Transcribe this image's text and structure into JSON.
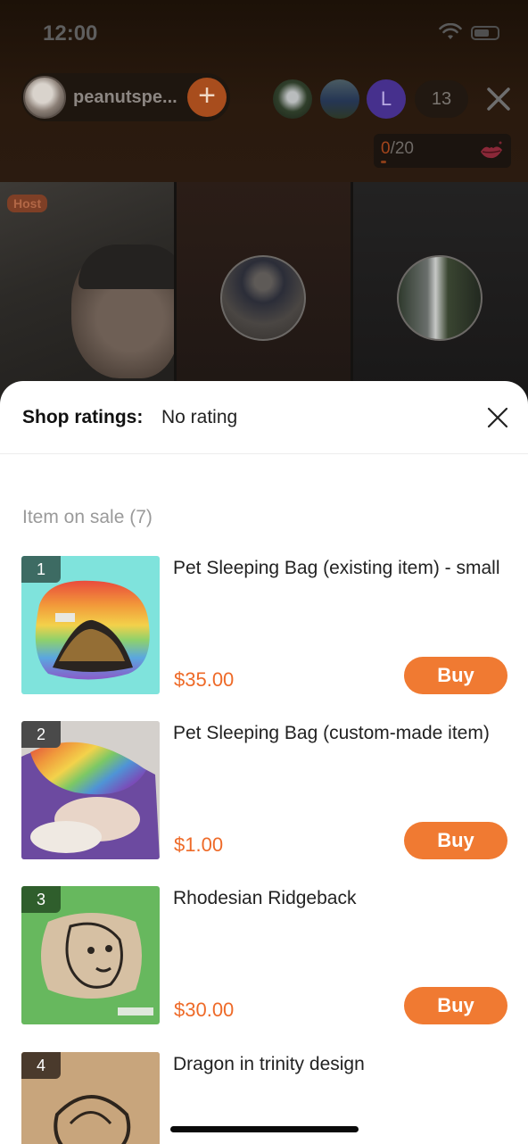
{
  "status_bar": {
    "time": "12:00"
  },
  "live": {
    "host_name": "peanutspe...",
    "follow_symbol": "+",
    "viewers": [
      {
        "kind": "photo",
        "initial": ""
      },
      {
        "kind": "photo",
        "initial": ""
      },
      {
        "kind": "letter",
        "initial": "L"
      }
    ],
    "viewer_count": "13",
    "gift_current": "0",
    "gift_total": "/20",
    "host_tag": "Host"
  },
  "sheet": {
    "ratings_label": "Shop ratings:",
    "ratings_value": "No rating",
    "section_title": "Item on sale (7)",
    "buy_label": "Buy",
    "items": [
      {
        "index": "1",
        "title": "Pet Sleeping Bag (existing item) - small",
        "price": "$35.00",
        "index_color": "#3d6b63",
        "bg": "#7fe3dc"
      },
      {
        "index": "2",
        "title": "Pet Sleeping Bag (custom-made item)",
        "price": "$1.00",
        "index_color": "#4a4a4a",
        "bg": "#cfcbc6"
      },
      {
        "index": "3",
        "title": "Rhodesian Ridgeback",
        "price": "$30.00",
        "index_color": "#2f5e2c",
        "bg": "#67b85e"
      },
      {
        "index": "4",
        "title": "Dragon in trinity design",
        "price": "",
        "index_color": "#4a3a2c",
        "bg": "#b08b62"
      }
    ]
  },
  "colors": {
    "accent": "#f07a32",
    "price": "#ee6a28"
  }
}
